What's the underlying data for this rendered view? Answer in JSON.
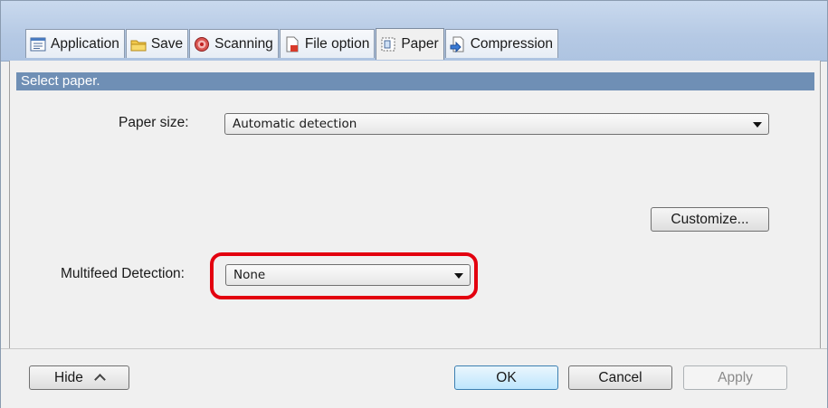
{
  "tabs": [
    {
      "label": "Application",
      "icon": "application-icon",
      "active": false
    },
    {
      "label": "Save",
      "icon": "save-folder-icon",
      "active": false
    },
    {
      "label": "Scanning",
      "icon": "scanning-icon",
      "active": false
    },
    {
      "label": "File option",
      "icon": "file-option-icon",
      "active": false
    },
    {
      "label": "Paper",
      "icon": "paper-icon",
      "active": true
    },
    {
      "label": "Compression",
      "icon": "compression-icon",
      "active": false
    }
  ],
  "section": {
    "header": "Select paper."
  },
  "paper_size": {
    "label": "Paper size:",
    "value": "Automatic detection"
  },
  "customize_label": "Customize...",
  "multifeed": {
    "label": "Multifeed Detection:",
    "value": "None"
  },
  "footer": {
    "hide_label": "Hide",
    "ok_label": "OK",
    "cancel_label": "Cancel",
    "apply_label": "Apply"
  },
  "colors": {
    "highlight": "#e3000f",
    "section_header": "#6f8fb5"
  }
}
